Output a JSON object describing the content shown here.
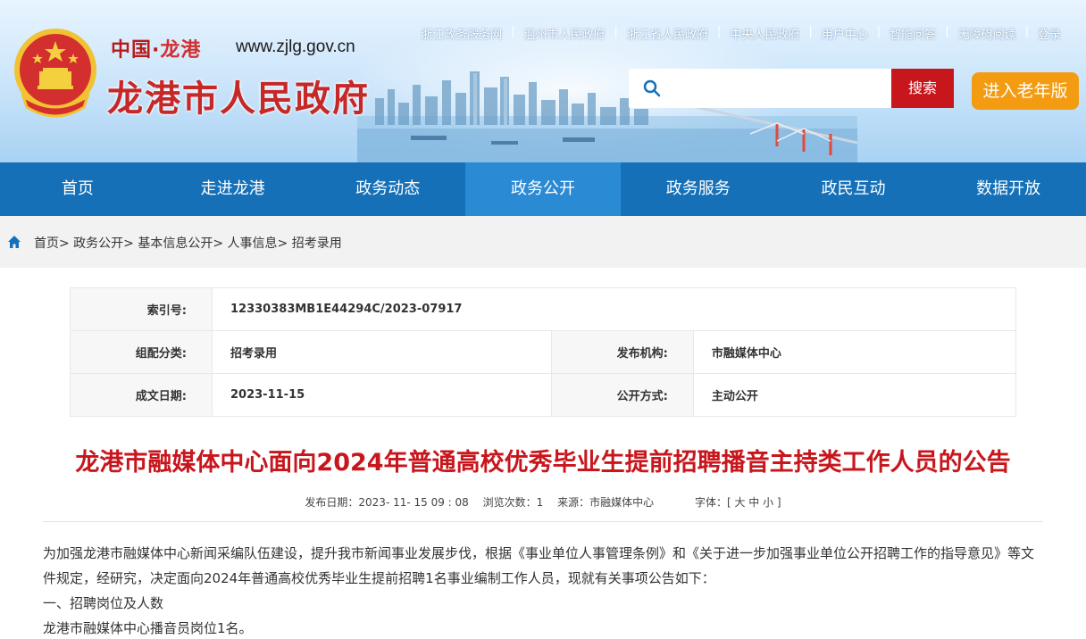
{
  "header": {
    "site_name_small_a": "中国",
    "site_name_small_dot": "·",
    "site_name_small_b": "龙港",
    "site_url": "www.zjlg.gov.cn",
    "site_name_big": "龙港市人民政府",
    "top_links": [
      "浙江政务服务网",
      "温州市人民政府",
      "浙江省人民政府",
      "中央人民政府",
      "用户中心",
      "智能问答",
      "无障碍阅读",
      "登录"
    ],
    "search": {
      "placeholder": "",
      "button": "搜索"
    },
    "elder_mode": "进入老年版"
  },
  "nav": {
    "items": [
      "首页",
      "走进龙港",
      "政务动态",
      "政务公开",
      "政务服务",
      "政民互动",
      "数据开放"
    ],
    "active": "政务公开"
  },
  "breadcrumb": "首页> 政务公开> 基本信息公开> 人事信息> 招考录用",
  "meta": {
    "index_label": "索引号:",
    "index_value": "12330383MB1E44294C/2023-07917",
    "category_label": "组配分类:",
    "category_value": "招考录用",
    "publisher_label": "发布机构:",
    "publisher_value": "市融媒体中心",
    "date_label": "成文日期:",
    "date_value": "2023-11-15",
    "open_label": "公开方式:",
    "open_value": "主动公开"
  },
  "article": {
    "title": "龙港市融媒体中心面向2024年普通高校优秀毕业生提前招聘播音主持类工作人员的公告",
    "publish_date": "发布日期：2023- 11- 15 09 : 08",
    "views": "浏览次数：1",
    "source": "来源：市融媒体中心",
    "font_size": "字体：[ 大 中 小 ]",
    "paragraphs": [
      "为加强龙港市融媒体中心新闻采编队伍建设，提升我市新闻事业发展步伐，根据《事业单位人事管理条例》和《关于进一步加强事业单位公开招聘工作的指导意见》等文件规定，经研究，决定面向2024年普通高校优秀毕业生提前招聘1名事业编制工作人员，现就有关事项公告如下：",
      "一、招聘岗位及人数",
      "龙港市融媒体中心播音员岗位1名。"
    ]
  },
  "colors": {
    "nav": "#1670b7",
    "nav_active": "#2b8ad4",
    "title": "#c8161d",
    "search_button": "#c8161d",
    "elder_button": "#f39c12"
  },
  "icons": {
    "emblem": "national-emblem-icon",
    "search": "search-icon",
    "home": "home-icon"
  }
}
